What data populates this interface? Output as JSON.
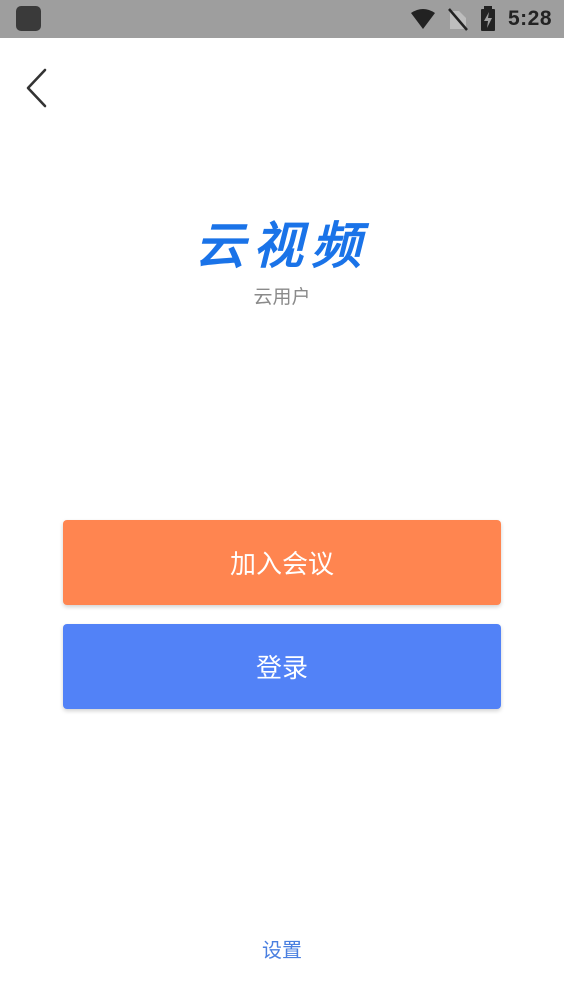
{
  "status_bar": {
    "time": "5:28",
    "icons": [
      "app-icon",
      "wifi-icon",
      "no-sim-icon",
      "battery-charging-icon"
    ]
  },
  "nav": {
    "back_icon": "chevron-left-icon"
  },
  "brand": {
    "title": "云视频",
    "subtitle": "云用户",
    "color": "#1a73e8"
  },
  "actions": {
    "join_label": "加入会议",
    "login_label": "登录",
    "join_color": "#ff8550",
    "login_color": "#5282f7"
  },
  "footer": {
    "settings_label": "设置"
  }
}
